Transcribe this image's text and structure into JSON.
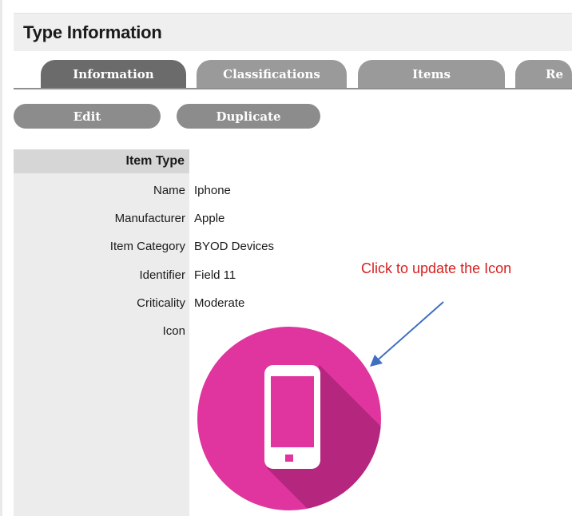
{
  "header": {
    "title": "Type Information"
  },
  "tabs": [
    {
      "label": "Information",
      "active": true
    },
    {
      "label": "Classifications",
      "active": false
    },
    {
      "label": "Items",
      "active": false
    },
    {
      "label": "Re",
      "active": false
    }
  ],
  "actions": {
    "edit_label": "Edit",
    "duplicate_label": "Duplicate"
  },
  "section": {
    "title": "Item Type"
  },
  "fields": [
    {
      "label": "Name",
      "value": "Iphone"
    },
    {
      "label": "Manufacturer",
      "value": "Apple"
    },
    {
      "label": "Item Category",
      "value": "BYOD Devices"
    },
    {
      "label": "Identifier",
      "value": "Field 11"
    },
    {
      "label": "Criticality",
      "value": "Moderate"
    },
    {
      "label": "Icon",
      "value": ""
    }
  ],
  "annotation": {
    "text": "Click to update the Icon",
    "color": "#d81f1f"
  },
  "icon": {
    "name": "mobile-phone-icon",
    "circle_color": "#e0359f",
    "shadow_color": "#b5267f"
  },
  "colors": {
    "tab_active": "#6b6b6b",
    "tab_inactive": "#9a9a9a",
    "button": "#8c8c8c",
    "arrow": "#3f6fc0"
  }
}
